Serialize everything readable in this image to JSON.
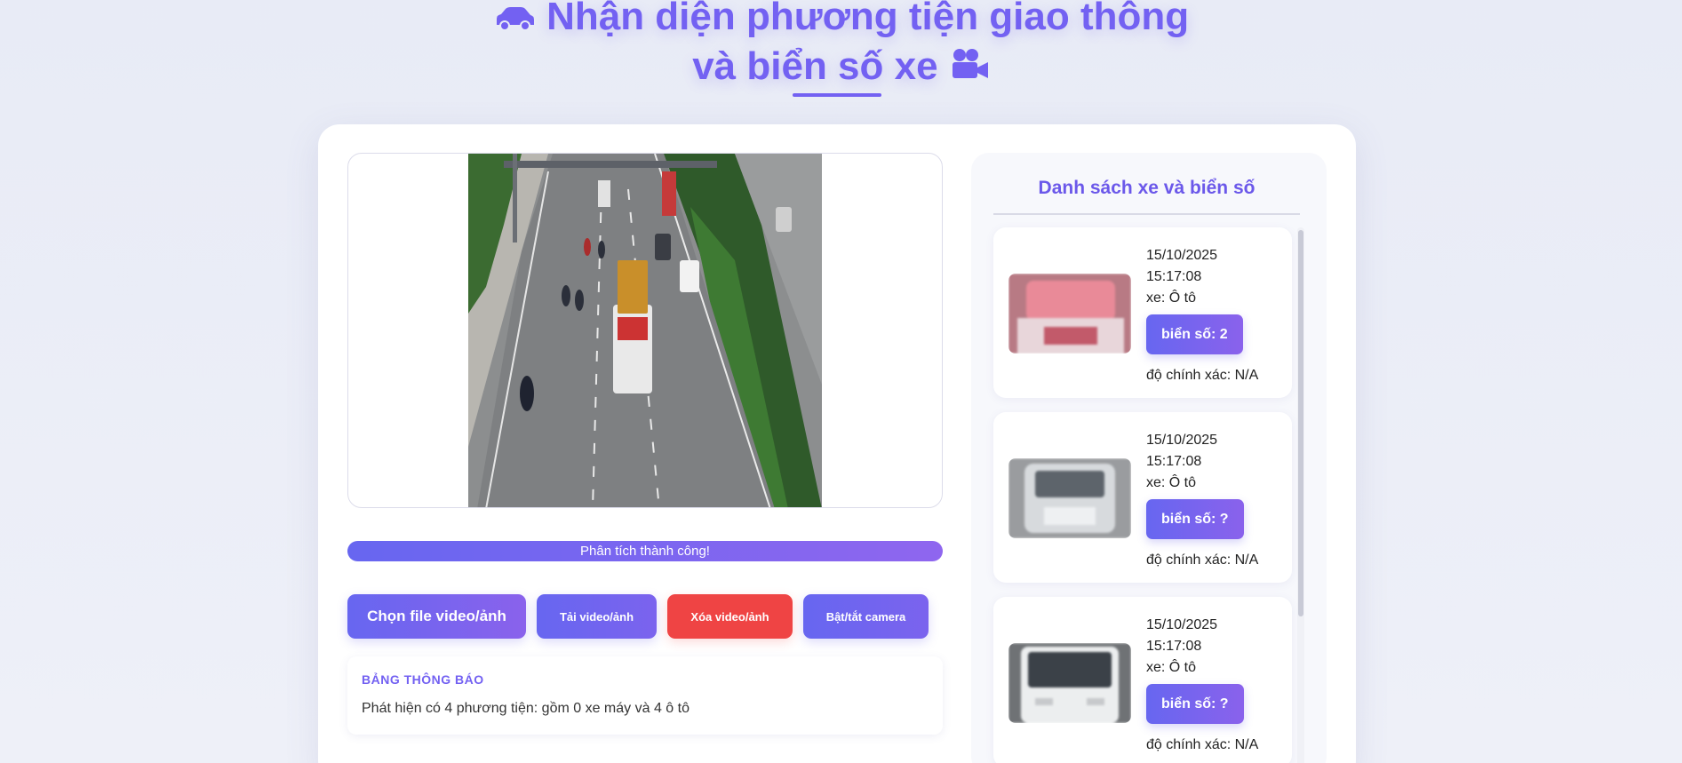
{
  "header": {
    "title_line1": "Nhận diện phương tiện giao thông",
    "title_line2": "và biển số xe",
    "left_icon": "car-icon",
    "right_icon": "video-camera-icon",
    "accent_color": "#7361f2"
  },
  "viewer": {
    "status_text": "Phân tích thành công!",
    "progress_percent": 100
  },
  "toolbar": {
    "choose_label": "Chọn file video/ảnh",
    "upload_label": "Tải video/ảnh",
    "delete_label": "Xóa video/ảnh",
    "camera_label": "Bật/tắt camera",
    "delete_color": "#ef4444"
  },
  "notice": {
    "title": "BẢNG THÔNG BÁO",
    "text": "Phát hiện có 4 phương tiện: gồm 0 xe máy và 4 ô tô"
  },
  "side_panel": {
    "title": "Danh sách xe và biển số",
    "entries": [
      {
        "date": "15/10/2025",
        "time": "15:17:08",
        "vehicle": "xe: Ô tô",
        "plate": "biển số: 2",
        "accuracy": "độ chính xác: N/A"
      },
      {
        "date": "15/10/2025",
        "time": "15:17:08",
        "vehicle": "xe: Ô tô",
        "plate": "biển số: ?",
        "accuracy": "độ chính xác: N/A"
      },
      {
        "date": "15/10/2025",
        "time": "15:17:08",
        "vehicle": "xe: Ô tô",
        "plate": "biển số: ?",
        "accuracy": "độ chính xác: N/A"
      }
    ]
  }
}
